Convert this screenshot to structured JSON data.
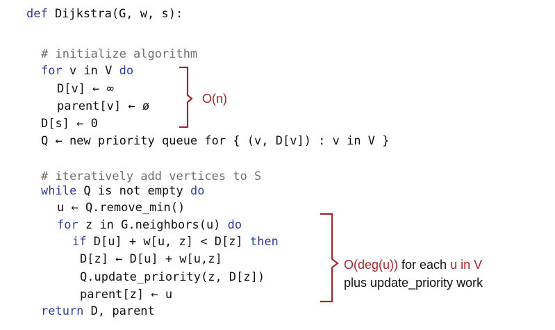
{
  "code": {
    "signature": {
      "kw": "def",
      "rest": " Dijkstra(G, w, s):"
    },
    "comment_init": "# initialize algorithm",
    "for_v": {
      "kw1": "for",
      "mid": " v in V ",
      "kw2": "do"
    },
    "dv_inf": "D[v] ← ∞",
    "parent_null": "parent[v] ← ø",
    "ds_zero": "D[s] ← 0",
    "queue_init": "Q ← new priority queue for { (v, D[v]) : v in V }",
    "comment_iter": "# iteratively add vertices to S",
    "while_q": {
      "kw1": "while",
      "mid": " Q is not empty ",
      "kw2": "do"
    },
    "remove_min": "u ← Q.remove_min()",
    "for_z": {
      "kw1": "for",
      "mid": " z in G.neighbors(u) ",
      "kw2": "do"
    },
    "if_cond": {
      "kw1": "if",
      "mid": " D[u] + w[u, z] < D[z] ",
      "kw2": "then"
    },
    "dz_update": "D[z] ← D[u] + w[u,z]",
    "update_priority": "Q.update_priority(z, D[z])",
    "parent_update": "parent[z] ← u",
    "return_stmt": {
      "kw": "return",
      "rest": " D, parent"
    }
  },
  "annotations": {
    "init_cost": "O(n)",
    "loop_cost_red1": "O(deg(u))",
    "loop_cost_mid": " for each ",
    "loop_cost_red2": "u in V",
    "loop_cost_line2": "plus update_priority work"
  },
  "colors": {
    "keyword": "#2d3e9c",
    "annotation_red": "#a3262a",
    "comment": "#6f6f6f",
    "text": "#111111"
  }
}
